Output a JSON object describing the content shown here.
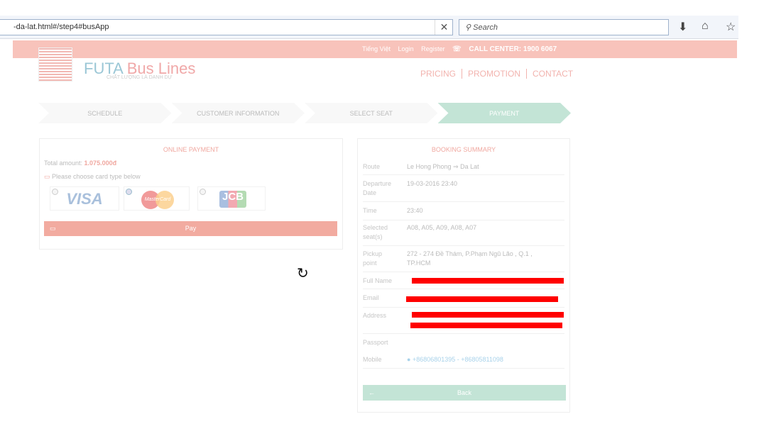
{
  "browser": {
    "url": "-da-lat.html#/step4#busApp",
    "search_placeholder": "Search",
    "clear": "✕",
    "icons": [
      "download-icon",
      "home-icon",
      "bookmark-star-icon"
    ]
  },
  "topbar": {
    "language": "Tiếng Việt",
    "login": "Login",
    "register": "Register",
    "call_center": "CALL CENTER: 1900 6067"
  },
  "brand": {
    "name_1": "FUTA",
    "name_2": "Bus Lines",
    "tagline": "CHẤT LƯỢNG LÀ DANH DỰ"
  },
  "nav": [
    "PRICING",
    "PROMOTION",
    "CONTACT"
  ],
  "steps": [
    "SCHEDULE",
    "CUSTOMER INFORMATION",
    "SELECT SEAT",
    "PAYMENT"
  ],
  "payment": {
    "title": "ONLINE PAYMENT",
    "total_label": "Total amount:",
    "total_value": "1.075.000đ",
    "choose": "Please choose card type below",
    "cards": [
      "VISA",
      "MasterCard",
      "JCB"
    ],
    "selected_card": "MasterCard",
    "pay": "Pay"
  },
  "summary": {
    "title": "BOOKING SUMMARY",
    "rows": [
      {
        "k": "Route",
        "v": "Le Hong Phong ⇒ Da Lat"
      },
      {
        "k": "Departure Date",
        "v": "19-03-2016 23:40"
      },
      {
        "k": "Time",
        "v": "23:40"
      },
      {
        "k": "Selected seat(s)",
        "v": "A08, A05, A09, A08, A07"
      },
      {
        "k": "Pickup point",
        "v": "272 - 274 Đề Thám, P.Phạm Ngũ Lão , Q.1 , TP.HCM"
      },
      {
        "k": "Full Name",
        "v": ""
      },
      {
        "k": "Email",
        "v": ""
      },
      {
        "k": "Address",
        "v": ""
      },
      {
        "k": "Passport",
        "v": ""
      },
      {
        "k": "Mobile",
        "v": "+86806801395 - +86805811098"
      }
    ],
    "back": "Back"
  },
  "colors": {
    "pink": "#f8c3bb",
    "green": "#c3e4d6",
    "redaction": "#ff0000"
  }
}
